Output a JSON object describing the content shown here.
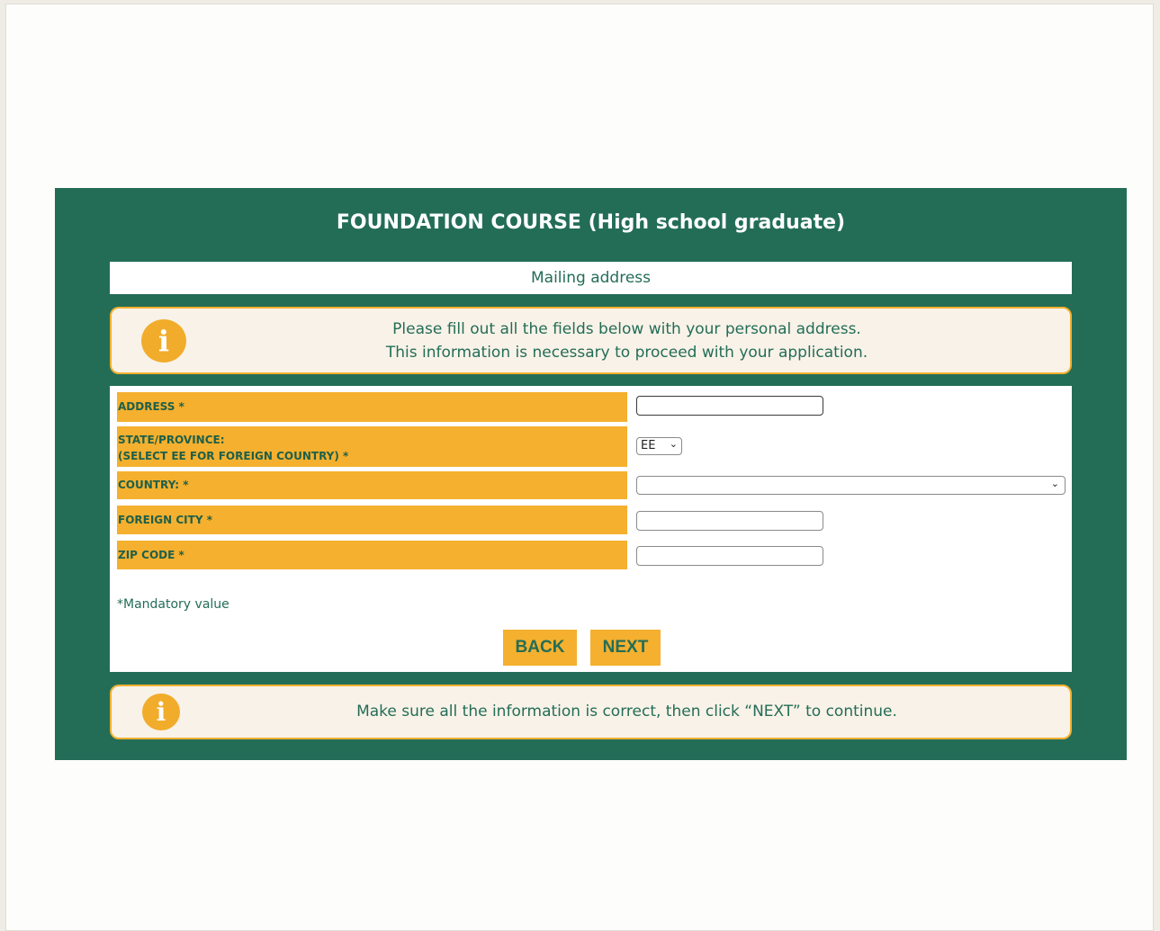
{
  "form": {
    "title": "FOUNDATION COURSE (High school graduate)",
    "section_title": "Mailing address",
    "intro": {
      "icon": "info-icon",
      "line1": "Please fill out all the fields below with your personal address.",
      "line2": "This information is necessary to proceed with your application."
    },
    "fields": {
      "address": {
        "label": "ADDRESS *",
        "value": ""
      },
      "state": {
        "label_line1": "STATE/PROVINCE:",
        "label_line2": "(SELECT EE FOR FOREIGN COUNTRY) *",
        "selected": "EE"
      },
      "country": {
        "label": "COUNTRY: *",
        "selected": ""
      },
      "foreign_city": {
        "label": "FOREIGN CITY *",
        "value": ""
      },
      "zip": {
        "label": "ZIP CODE *",
        "value": ""
      }
    },
    "mandatory_note": "*Mandatory value",
    "buttons": {
      "back": "BACK",
      "next": "NEXT"
    },
    "footer_note": {
      "icon": "info-icon",
      "text": "Make sure all the information is correct, then click “NEXT” to continue."
    }
  },
  "colors": {
    "panel_green": "#236d57",
    "accent_orange": "#f4b02e",
    "info_bg": "#f9f2e8"
  }
}
